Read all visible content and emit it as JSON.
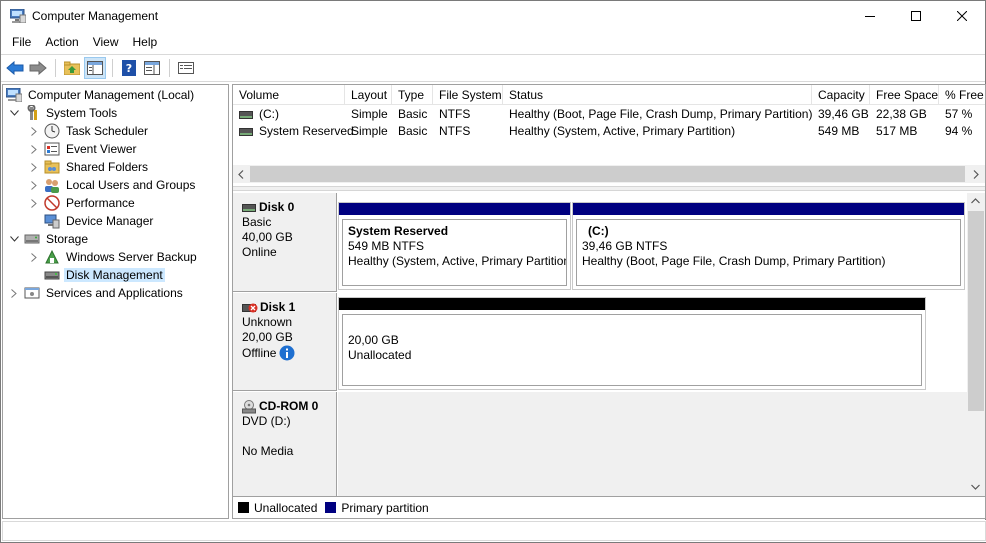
{
  "window": {
    "title": "Computer Management",
    "icon": "computer-management-icon",
    "controls": [
      "minimize-icon",
      "maximize-icon",
      "close-icon"
    ]
  },
  "menu": {
    "items": [
      "File",
      "Action",
      "View",
      "Help"
    ]
  },
  "toolbar": {
    "buttons": [
      "back-arrow-icon",
      "forward-arrow-icon",
      "up-folder-icon",
      "show-hide-tree-icon",
      "help-icon",
      "show-hide-action-pane-icon",
      "properties-icon"
    ]
  },
  "tree": {
    "root": "Computer Management (Local)",
    "system_tools": "System Tools",
    "task_scheduler": "Task Scheduler",
    "event_viewer": "Event Viewer",
    "shared_folders": "Shared Folders",
    "local_users": "Local Users and Groups",
    "performance": "Performance",
    "device_manager": "Device Manager",
    "storage": "Storage",
    "windows_server_backup": "Windows Server Backup",
    "disk_management": "Disk Management",
    "services_apps": "Services and Applications"
  },
  "volumes": {
    "headers": [
      "Volume",
      "Layout",
      "Type",
      "File System",
      "Status",
      "Capacity",
      "Free Space",
      "% Free"
    ],
    "rows": [
      [
        "(C:)",
        "Simple",
        "Basic",
        "NTFS",
        "Healthy (Boot, Page File, Crash Dump, Primary Partition)",
        "39,46 GB",
        "22,38 GB",
        "57 %"
      ],
      [
        "System Reserved",
        "Simple",
        "Basic",
        "NTFS",
        "Healthy (System, Active, Primary Partition)",
        "549 MB",
        "517 MB",
        "94 %"
      ]
    ]
  },
  "disks": {
    "disk0": {
      "name": "Disk 0",
      "type": "Basic",
      "size": "40,00 GB",
      "state": "Online",
      "partitions": [
        {
          "title": "System Reserved",
          "size": "549 MB NTFS",
          "status": "Healthy (System, Active, Primary Partition)"
        },
        {
          "title": "(C:)",
          "size": "39,46 GB NTFS",
          "status": "Healthy (Boot, Page File, Crash Dump, Primary Partition)"
        }
      ]
    },
    "disk1": {
      "name": "Disk 1",
      "type": "Unknown",
      "size": "20,00 GB",
      "state": "Offline",
      "partition": {
        "size": "20,00 GB",
        "status": "Unallocated"
      }
    },
    "cdrom0": {
      "name": "CD-ROM 0",
      "drive": "DVD (D:)",
      "media": "No Media"
    }
  },
  "legend": {
    "unallocated": "Unallocated",
    "primary": "Primary partition"
  },
  "colors": {
    "primary_partition": "#000080",
    "unallocated": "#000000",
    "selection": "#cce8ff"
  }
}
